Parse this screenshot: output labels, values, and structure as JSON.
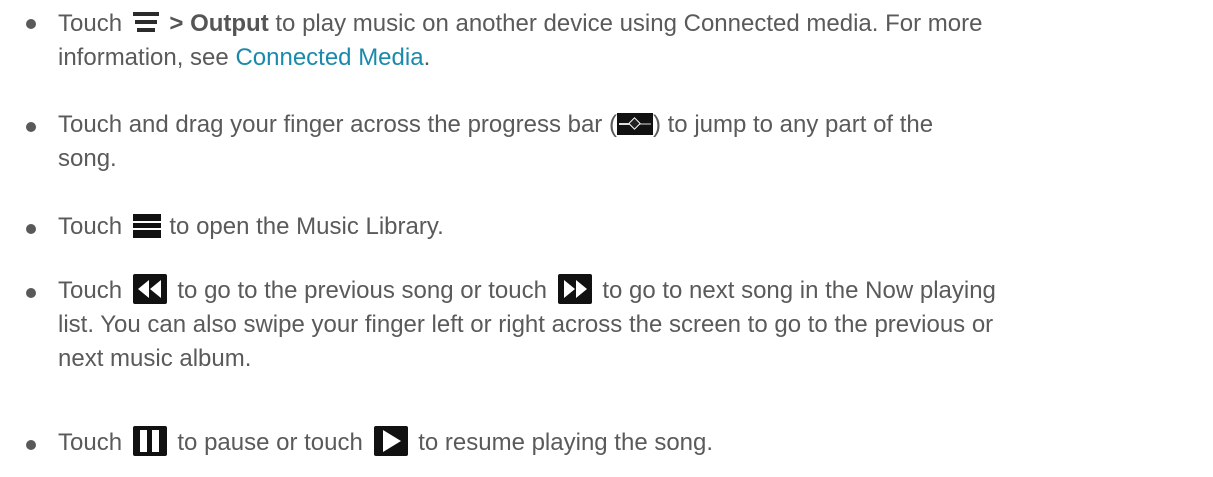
{
  "items": [
    {
      "touch": "Touch",
      "gt": ">",
      "output": "Output",
      "line1_rest": "to play music on another device using Connected media. For more",
      "line2_pre": "information, see",
      "link": "Connected Media",
      "line2_post": "."
    },
    {
      "line1_pre": "Touch and drag your finger across the progress bar (",
      "line1_post": ") to jump to any part of the",
      "line2": "song."
    },
    {
      "pre": "Touch",
      "post": "to open the Music Library."
    },
    {
      "pre": "Touch",
      "mid": "to go to the previous song or touch",
      "line1_post": "to go to next song in the Now playing",
      "line2": "list. You can also swipe your finger left or right across the screen to go to the previous or",
      "line3": "next music album."
    },
    {
      "pre": "Touch",
      "mid": "to pause or touch",
      "post": "to resume playing the song."
    }
  ],
  "icons": {
    "menu": "menu-icon",
    "progress": "progress-bar-icon",
    "library": "music-library-icon",
    "previous": "previous-icon",
    "next": "next-icon",
    "pause": "pause-icon",
    "play": "play-icon"
  },
  "colors": {
    "text": "#5a5a5a",
    "link": "#1a8aac",
    "icon_bg": "#111111"
  }
}
